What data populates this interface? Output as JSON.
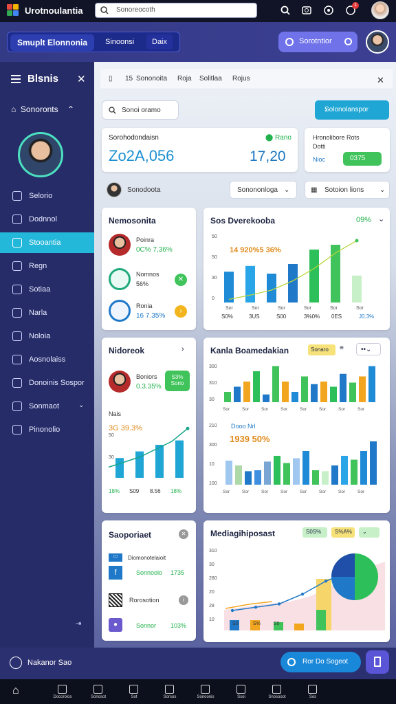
{
  "app": {
    "title": "Urotnoulantia",
    "search_placeholder": "Sonoreocoth"
  },
  "topbar": {
    "notification_count": "1"
  },
  "secondbar": {
    "tab1": "Smuplt Elonnonia",
    "tab2": "Sinoonsi",
    "tab3": "Daix",
    "action": "Sorotntior"
  },
  "sidebar": {
    "title": "Blsnis",
    "home": "Sonoronts",
    "items": [
      {
        "label": "Selorio",
        "icon": "camera-icon"
      },
      {
        "label": "Dodnnol",
        "icon": "document-icon"
      },
      {
        "label": "Stooantia",
        "icon": "message-icon",
        "active": true
      },
      {
        "label": "Regn",
        "icon": "comment-icon"
      },
      {
        "label": "Sotiaa",
        "icon": "user-icon"
      },
      {
        "label": "Narla",
        "icon": "person-icon"
      },
      {
        "label": "Noloia",
        "icon": "mail-icon"
      },
      {
        "label": "Aosnolaiss",
        "icon": "calendar-icon"
      },
      {
        "label": "Donoinis Sospor",
        "icon": "clock-icon"
      },
      {
        "label": "Sonmaot",
        "icon": "chat-icon"
      },
      {
        "label": "Pinonolio",
        "icon": "edit-icon"
      }
    ],
    "footer": "Nakanor Sao"
  },
  "breadcrumb": [
    "15",
    "Sononoita",
    "Roja",
    "Solitlaa",
    "Rojus"
  ],
  "toolbar": {
    "search_label": "Sonoi oramo",
    "action_button": "Solonolanspor"
  },
  "kpi": {
    "title": "Sorohodondaisn",
    "badge": "Rano",
    "value_left": "Zo2A,056",
    "value_right": "17,20",
    "side_title": "Hronolibore Rots",
    "side_sub": "Dotti",
    "side_label": "Nioc",
    "side_value": "0375"
  },
  "filters": {
    "user_label": "Sonodoota",
    "dropdown1": "Sonononloga",
    "dropdown2": "Sotoion lions"
  },
  "panel_people": {
    "title": "Nemosonita",
    "people": [
      {
        "name": "Poinra",
        "value": "0C% 7,36%"
      },
      {
        "name": "Nomnos",
        "value": "56%"
      },
      {
        "name": "Ronia",
        "value": "16 7.35%"
      }
    ]
  },
  "panel_growth": {
    "title": "Sos Dverekooba",
    "percent": "09%",
    "callout": "14 920%5 36%",
    "yticks": [
      "50",
      "50",
      "30",
      "0"
    ],
    "xticks": [
      "Sor",
      "Sor",
      "Sor",
      "Sor",
      "Sor",
      "Sor"
    ],
    "footer": [
      "S0%",
      "3US",
      "S00",
      "3%0%",
      "0ES",
      "J0.3%"
    ]
  },
  "panel_network": {
    "title": "Nidoreok",
    "person": "Boniors",
    "percent": "0.3.35%",
    "badge": "S3% Sorio",
    "label": "Nais",
    "value": "3G 39.3%",
    "yticks": [
      "50",
      "30"
    ],
    "footer": [
      "18%",
      "S09",
      "8.56",
      "18%"
    ]
  },
  "panel_bars": {
    "title": "Kanla Boamedakian",
    "badge": "Sonaro",
    "subtitle": "Dooo Nrl",
    "value": "1939 50%",
    "yticks": [
      "300",
      "310",
      "30",
      "210",
      "300",
      "10",
      "100"
    ],
    "xticks": [
      "Sor",
      "Sor",
      "Sor",
      "Sor",
      "Sor",
      "Sor",
      "Sor",
      "Sor"
    ]
  },
  "panel_list": {
    "title": "Saoporiaet",
    "rows": [
      {
        "label": "Diomonotelaioit",
        "value": "1735",
        "sub": "Sonnoolo"
      },
      {
        "label": "Rorosotion",
        "value": "",
        "sub": ""
      },
      {
        "label": "Sonnor",
        "value": "103%",
        "sub": ""
      }
    ]
  },
  "panel_combo": {
    "title": "Mediagihiposast",
    "chips": [
      "S0S%",
      "S%A%",
      ""
    ],
    "yticks": [
      "310",
      "30",
      "280",
      "20",
      "28",
      "10"
    ],
    "labels": [
      "S0",
      "S%",
      "S0"
    ]
  },
  "bottom_cta": {
    "label": "Ror Do Sogeot"
  },
  "bottom_nav": [
    "Docorolos",
    "Sonosot",
    "Sot",
    "Sorsos",
    "Sonoonis",
    "Ssoi",
    "Snosooot",
    "Sos"
  ],
  "chart_data": [
    {
      "type": "bar",
      "title": "Sos Dverekooba",
      "values": [
        32,
        38,
        30,
        40,
        55,
        60,
        28
      ],
      "line": [
        5,
        12,
        20,
        35,
        55,
        80,
        100
      ]
    },
    {
      "type": "line",
      "title": "Nidoreok",
      "values": [
        10,
        20,
        30,
        45,
        60,
        85
      ]
    },
    {
      "type": "bar",
      "title": "Kanla Boamedakian",
      "values": [
        20,
        30,
        40,
        60,
        15,
        70,
        40,
        20,
        50,
        35,
        40,
        30,
        55,
        38,
        50,
        70
      ]
    },
    {
      "type": "area",
      "title": "Mediagihiposast",
      "values": [
        20,
        25,
        30,
        45,
        65,
        80
      ]
    }
  ],
  "colors": {
    "accent": "#1fa6d4",
    "brand": "#2d3fb0",
    "sidebar": "#262c68",
    "green": "#22b14c"
  }
}
